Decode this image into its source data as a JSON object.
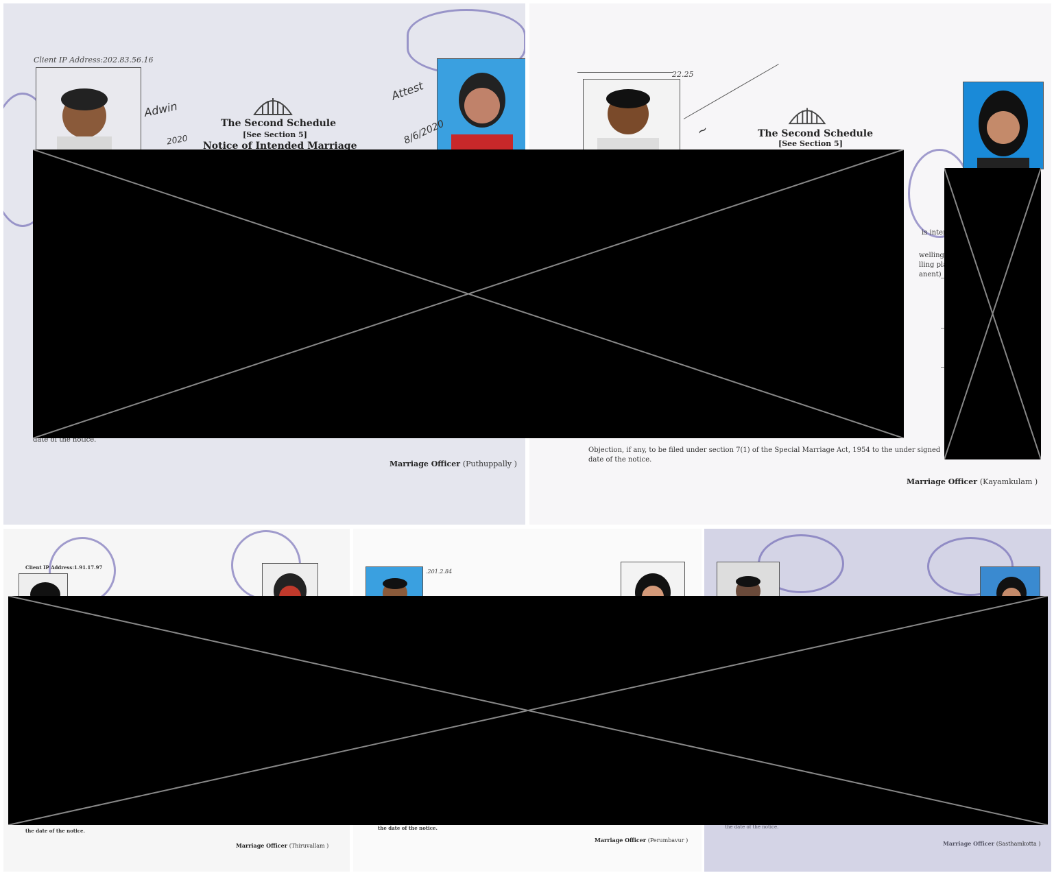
{
  "panel1": {
    "client_ip": "Client IP Address:202.83.56.16",
    "schedule_title": "The Second Schedule",
    "section_ref": "[See Section 5]",
    "notice_title": "Notice of Intended Marriage",
    "footer_fragment": "date of the notice.",
    "officer_label": "Marriage Officer",
    "officer_place": "(Puthuppally )",
    "signature_groom": "Adwin",
    "signature_date_left": "2020",
    "attest_text": "Attest",
    "signature_date_right": "8/6/2020"
  },
  "panel2": {
    "client_ip_fragment": "22.25",
    "schedule_title": "The Second Schedule",
    "section_ref": "[See Section 5]",
    "frag_intended": "is intended",
    "frag_dwelling1": "welling Pla",
    "frag_dwelling2": "lling place",
    "frag_dwelling3": "anent)",
    "objection_line1": "Objection, if any, to be filed under section 7(1) of the Special Marriage Act, 1954 to the under signed",
    "objection_line2": "date of the notice.",
    "officer_label": "Marriage Officer",
    "officer_place": "(Kayamkulam )"
  },
  "panel3": {
    "client_ip": "Client IP Address:",
    "ip_fragment": "1.91.17.97",
    "footer_fragment": "the date of the notice.",
    "officer_label": "Marriage Officer",
    "officer_place": "(Thiruvallam )"
  },
  "panel4": {
    "ip_fragment": ".201.2.84",
    "footer_fragment": "the date of the notice.",
    "officer_label": "Marriage Officer",
    "officer_place": "(Perumbavur )"
  },
  "panel5": {
    "footer_fragment": "the date of the notice.",
    "officer_label": "Marriage Officer",
    "officer_place": "(Sasthamkotta )"
  },
  "colors": {
    "redaction": "#000000",
    "stamp": "#5a50aa",
    "photo_bg_blue": "#3aa0e0"
  }
}
